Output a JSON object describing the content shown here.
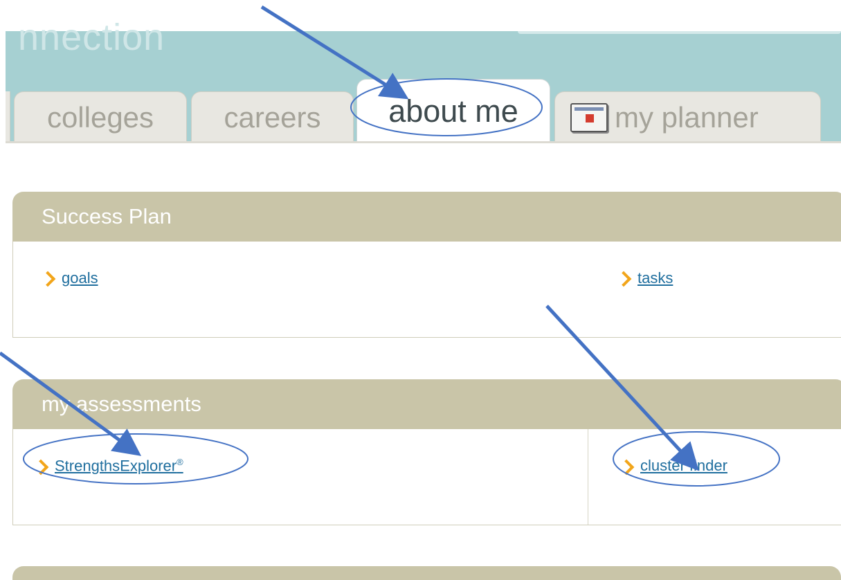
{
  "header": {
    "brand_fragment": "nnection",
    "tabs": [
      {
        "label": "colleges",
        "active": false
      },
      {
        "label": "careers",
        "active": false
      },
      {
        "label": "about me",
        "active": true
      },
      {
        "label": "my planner",
        "active": false,
        "icon": "calendar-icon"
      }
    ]
  },
  "success_plan": {
    "title": "Success Plan",
    "links": [
      "goals",
      "tasks"
    ]
  },
  "assessments": {
    "title": "my assessments",
    "links": [
      "StrengthsExplorer",
      "cluster finder"
    ],
    "registered_mark": "®"
  },
  "colors": {
    "header_band": "#a6d0d2",
    "panel_header": "#c9c5a8",
    "link": "#1f6e9e",
    "chevron": "#f2a51a",
    "annotation": "#4472c4"
  }
}
